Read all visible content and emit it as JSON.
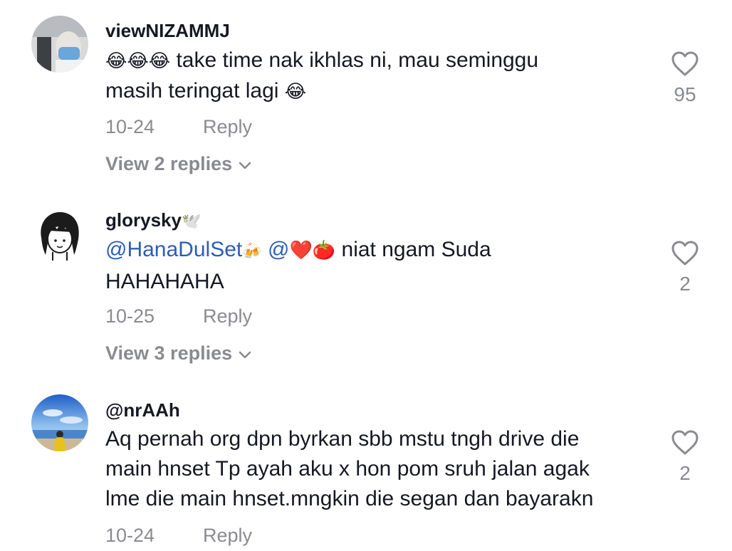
{
  "comments": [
    {
      "username": "viewNIZAMMJ",
      "text_parts": {
        "line1_emoji": "😂😂😂",
        "line1": " take time nak ikhlas ni, mau seminggu",
        "line2": "masih teringat lagi ",
        "line2_emoji": "😂"
      },
      "date": "10-24",
      "reply_label": "Reply",
      "view_replies": "View 2 replies",
      "likes": "95"
    },
    {
      "username": "glorysky",
      "username_emoji": "🕊️",
      "mention1": "@HanaDulSet",
      "mention1_emoji": "🍻",
      "mention2": "@",
      "mention2_emoji": "❤️🍅",
      "text_line1": " niat ngam Suda",
      "text_line2": "HAHAHAHA",
      "date": "10-25",
      "reply_label": "Reply",
      "view_replies": "View 3 replies",
      "likes": "2"
    },
    {
      "username": "@nrAAh",
      "text": "Aq pernah org dpn byrkan sbb mstu tngh drive die\nmain hnset Tp ayah aku x hon pom sruh jalan agak\nlme die main hnset.mngkin die segan dan bayarakn",
      "date": "10-24",
      "reply_label": "Reply",
      "likes": "2"
    }
  ],
  "icons": {
    "like": "heart-outline-icon",
    "expand": "chevron-down-icon"
  },
  "colors": {
    "text": "#161823",
    "muted": "#8a8b91",
    "mention": "#2b5db9"
  }
}
